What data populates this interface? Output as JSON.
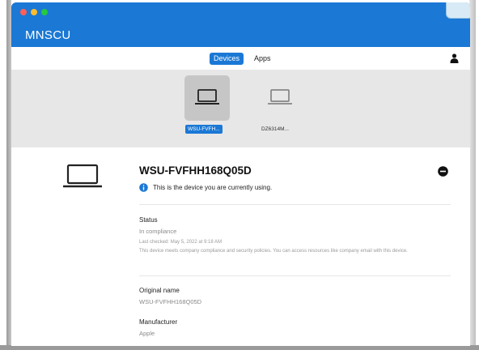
{
  "app": {
    "title": "MNSCU",
    "colors": {
      "accent": "#1b78d5",
      "strip": "#e7e7e7",
      "selected_tile": "#c6c6c6"
    }
  },
  "tabs": [
    {
      "label": "Devices",
      "selected": true
    },
    {
      "label": "Apps",
      "selected": false
    }
  ],
  "devices": [
    {
      "label": "WSU-FVFH...",
      "icon": "laptop-icon",
      "selected": true
    },
    {
      "label": "DZ6314M...",
      "icon": "laptop-icon",
      "selected": false
    }
  ],
  "detail": {
    "device_name": "WSU-FVFHH168Q05D",
    "current_device_note": "This is the device you are currently using.",
    "status": {
      "label": "Status",
      "value": "In compliance",
      "last_checked": "Last checked: May 5, 2022 at 9:18 AM",
      "description": "This device meets company compliance and security policies. You can access resources like company email with this device."
    },
    "original_name": {
      "label": "Original name",
      "value": "WSU-FVFHH168Q05D"
    },
    "manufacturer": {
      "label": "Manufacturer",
      "value": "Apple"
    }
  }
}
